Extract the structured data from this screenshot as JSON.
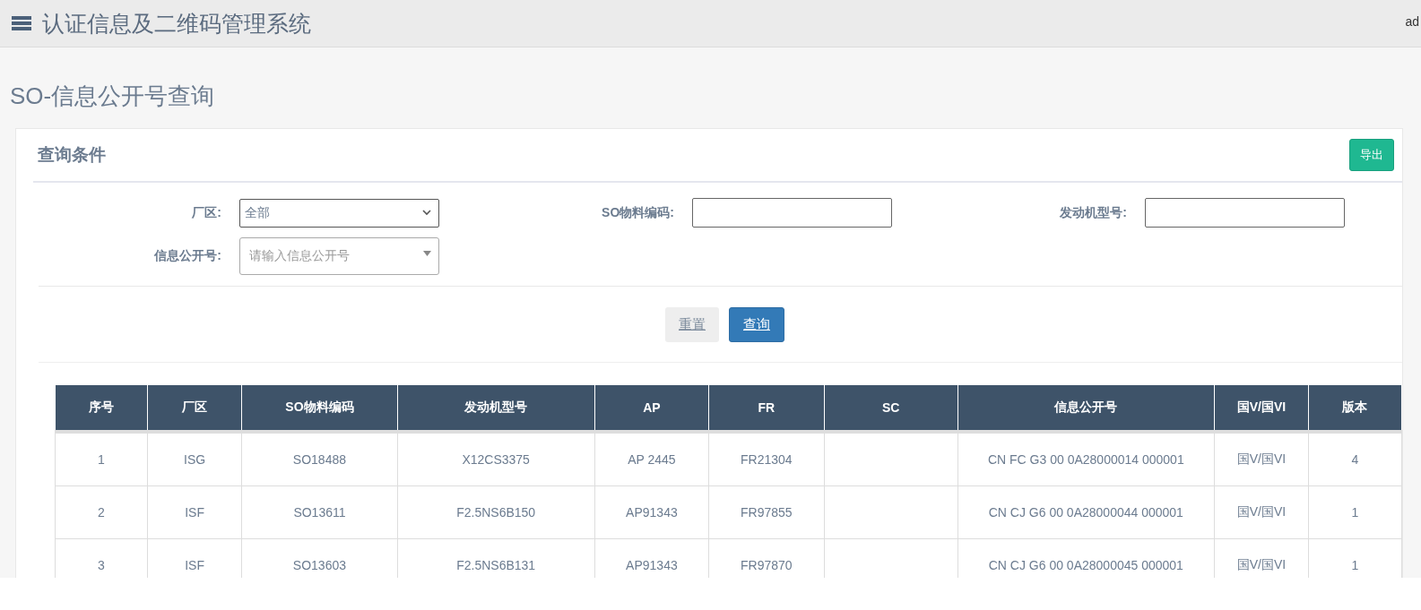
{
  "header": {
    "title": "认证信息及二维码管理系统",
    "user": "ad"
  },
  "page_title": "SO-信息公开号查询",
  "panel": {
    "title": "查询条件",
    "export_button": "导出",
    "filters": [
      {
        "kind": "select",
        "label": "厂区:",
        "value": "全部"
      },
      {
        "kind": "input",
        "label": "SO物料编码:"
      },
      {
        "kind": "input",
        "label": "发动机型号:"
      },
      {
        "kind": "combo",
        "label": "信息公开号:",
        "placeholder": "请输入信息公开号"
      }
    ],
    "reset_button": "重置",
    "search_button": "查询"
  },
  "table": {
    "columns": [
      "序号",
      "厂区",
      "SO物料编码",
      "发动机型号",
      "AP",
      "FR",
      "SC",
      "信息公开号",
      "国V/国VI",
      "版本"
    ],
    "rows": [
      [
        "1",
        "ISG",
        "SO18488",
        "X12CS3375",
        "AP 2445",
        "FR21304",
        "",
        "CN FC G3 00 0A28000014 000001",
        "国V/国VI",
        "4"
      ],
      [
        "2",
        "ISF",
        "SO13611",
        "F2.5NS6B150",
        "AP91343",
        "FR97855",
        "",
        "CN CJ G6 00 0A28000044 000001",
        "国V/国VI",
        "1"
      ],
      [
        "3",
        "ISF",
        "SO13603",
        "F2.5NS6B131",
        "AP91343",
        "FR97870",
        "",
        "CN CJ G6 00 0A28000045 000001",
        "国V/国VI",
        "1"
      ]
    ]
  }
}
